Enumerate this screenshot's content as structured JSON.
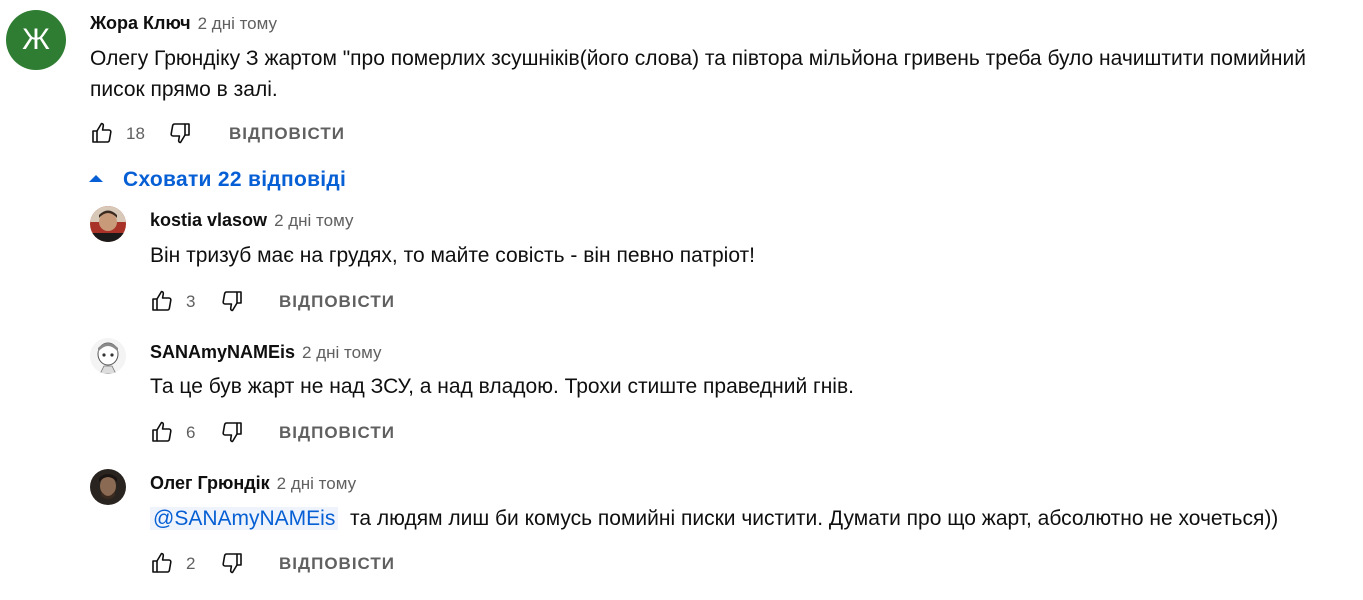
{
  "top_comment": {
    "avatar_letter": "Ж",
    "author": "Жора Ключ",
    "time": "2 дні тому",
    "text_line1": "Олегу Грюндіку  З жартом \"про померлих зсушніків(його слова) та півтора мільйона гривень треба було начиштити помийний",
    "text_line2": "писок  прямо в залі.",
    "likes": "18",
    "reply_label": "ВІДПОВІСТИ"
  },
  "hide_replies_label": "Сховати 22 відповіді",
  "replies": [
    {
      "author": "kostia vlasow",
      "time": "2 дні тому",
      "text": "Він тризуб має на грудях, то майте совість - він певно патріот!",
      "likes": "3",
      "reply_label": "ВІДПОВІСТИ"
    },
    {
      "author": "SANAmyNAMEis",
      "time": "2 дні тому",
      "text": "Та це був жарт не над ЗСУ, а над владою. Трохи стиште праведний гнів.",
      "likes": "6",
      "reply_label": "ВІДПОВІСТИ"
    },
    {
      "author": "Олег Грюндік",
      "time": "2 дні тому",
      "mention": "@SANAmyNAMEis",
      "text": "та людям лиш би комусь помийні писки чистити. Думати про що жарт, абсолютно не хочеться))",
      "likes": "2",
      "reply_label": "ВІДПОВІСТИ"
    }
  ],
  "colors": {
    "link": "#065fd4",
    "secondary_text": "#606060",
    "avatar_green": "#2e7d32"
  }
}
